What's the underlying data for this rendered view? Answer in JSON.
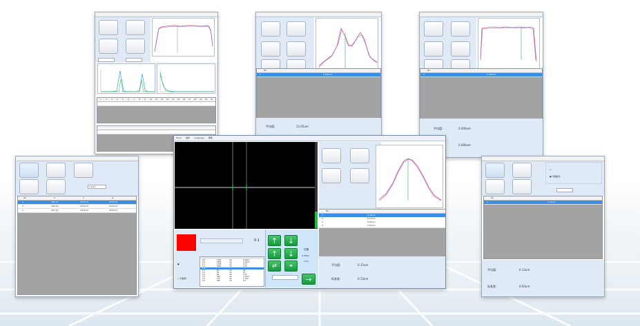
{
  "colors": {
    "panel": "#dfeaf6",
    "gray_area": "#a3a3a3",
    "selection": "#3a8ee6",
    "green": "#16993d",
    "red": "#ff0000",
    "pink": "#e05a7a",
    "purple": "#8a6ad2",
    "cyan": "#1eaacc"
  },
  "icons": [
    "arrow-up-icon",
    "arrow-down-icon",
    "arrow-refresh-icon",
    "link-icon",
    "arrow-right-icon"
  ],
  "w1": {
    "tabs": [
      "",
      "",
      "",
      ""
    ],
    "buttons": [
      "",
      "",
      "",
      ""
    ],
    "series_labels": [
      "",
      "",
      ""
    ],
    "grid_head": [
      "1",
      "2",
      "3",
      "4",
      "5",
      "6",
      "7",
      "8",
      "9",
      "10",
      "11",
      "12",
      "13",
      "14",
      "15",
      "16",
      "17",
      "18",
      "19",
      "20",
      "21"
    ]
  },
  "w2": {
    "buttons": [
      "",
      "",
      "",
      ""
    ],
    "grid": {
      "header": [
        "No.",
        ""
      ],
      "rows": [
        [
          "1",
          "0.000um"
        ]
      ]
    },
    "stat_label": "平均值:",
    "stat_value": "13.05um"
  },
  "w3": {
    "buttons": [
      "",
      "",
      "",
      ""
    ],
    "grid": {
      "header": [
        "No.",
        ""
      ],
      "rows": [
        [
          "1",
          "2.000um"
        ]
      ]
    },
    "stat1_label": "平均值:",
    "stat1_value": "0.000um",
    "stat2_value": "0.000um"
  },
  "w4": {
    "buttons": [
      "",
      "",
      "",
      ""
    ],
    "input_value": "1.0um",
    "grid": {
      "header": [
        "No.",
        "X",
        "Y",
        "Z"
      ],
      "rows": [
        [
          "1",
          "380.72",
          "2030.07",
          "2030.07"
        ],
        [
          "2",
          "380.95",
          "2030.07",
          "2030.07"
        ],
        [
          "3",
          "421.22",
          "2030.07",
          "2030.07"
        ]
      ]
    }
  },
  "w5": {
    "buttons": [
      "",
      "",
      "",
      ""
    ],
    "radio_labels": [
      "",
      "平面模式"
    ],
    "input_value": "",
    "grid": {
      "header": [
        "No.",
        ""
      ],
      "rows": [
        [
          "1",
          "2.12um"
        ]
      ]
    },
    "stat1_label": "平均值:",
    "stat1_value": "0.13um",
    "stat2_label": "标准差:",
    "stat2_value": "0.03um"
  },
  "main": {
    "menu": [
      "Show",
      "操作",
      "Language",
      "帮助"
    ],
    "title_small": "",
    "z_value": "0.1",
    "radio_labels": [
      "",
      "外面测"
    ],
    "table": {
      "header": [
        "",
        "",
        "",
        ""
      ],
      "rows": [
        [
          "0.0",
          "1760",
          "um",
          "1.00um"
        ],
        [
          "0.0",
          "3560",
          "um",
          "1.00um"
        ],
        [
          "0.1",
          "1760",
          "um",
          "0.1X"
        ],
        [
          "1.0",
          "6180",
          "um",
          "1.0X"
        ],
        [
          "1.0",
          "",
          "",
          ""
        ],
        [
          "1.0",
          "50",
          "um",
          "2X"
        ],
        [
          "1.0",
          "50",
          "um",
          "2X"
        ],
        [
          "1.0",
          "60",
          "um",
          "3.3X"
        ],
        [
          "1.0",
          "160",
          "um",
          "2.72um"
        ],
        [
          "1.0",
          "175",
          "um",
          "2.7um"
        ],
        [
          "2.0",
          "250",
          "um",
          "0.2"
        ]
      ]
    },
    "right_label1": "位置",
    "right_label2": "4.5000",
    "right_label3": "1um",
    "buttons": [
      "",
      "",
      "",
      ""
    ],
    "grid": {
      "header": [
        "No.",
        ""
      ],
      "rows": [
        [
          "1",
          "0.39um"
        ],
        [
          "2",
          "9.19um"
        ],
        [
          "3",
          "0.00um"
        ],
        [
          "4",
          "0.00um"
        ]
      ]
    },
    "stat1_label": "平均值:",
    "stat1_value": "0.15um",
    "stat2_label": "标准差:",
    "stat2_value": "0.13um"
  }
}
